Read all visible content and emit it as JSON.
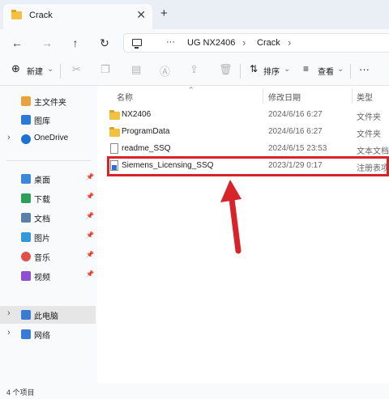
{
  "tab": {
    "title": "Crack",
    "close": "✕",
    "new": "+"
  },
  "nav": {
    "back": "←",
    "forward": "→",
    "up": "↑",
    "refresh": "↻"
  },
  "address": {
    "more": "···",
    "crumbs": [
      "UG NX2406",
      "Crack"
    ],
    "separator": "›"
  },
  "toolbar": {
    "new_label": "新建",
    "sort_label": "排序",
    "view_label": "查看",
    "more": "···"
  },
  "sidebar": {
    "items": [
      {
        "label": "主文件夹",
        "icon": "home-icon",
        "color": "#e8a33d"
      },
      {
        "label": "图库",
        "icon": "gallery-icon",
        "color": "#2a7ad6"
      },
      {
        "label": "OneDrive",
        "icon": "cloud-icon",
        "color": "#1e73d2"
      },
      {
        "label": "桌面",
        "icon": "desktop-icon",
        "color": "#3b88d8"
      },
      {
        "label": "下载",
        "icon": "download-icon",
        "color": "#2aa05a"
      },
      {
        "label": "文档",
        "icon": "documents-icon",
        "color": "#5a7fa8"
      },
      {
        "label": "图片",
        "icon": "pictures-icon",
        "color": "#3598db"
      },
      {
        "label": "音乐",
        "icon": "music-icon",
        "color": "#e0504a"
      },
      {
        "label": "视频",
        "icon": "video-icon",
        "color": "#8d4fd0"
      },
      {
        "label": "此电脑",
        "icon": "computer-icon",
        "color": "#3a7bd5"
      },
      {
        "label": "网络",
        "icon": "network-icon",
        "color": "#3a7bd5"
      }
    ]
  },
  "columns": {
    "name": "名称",
    "date": "修改日期",
    "type": "类型"
  },
  "files": [
    {
      "name": "NX2406",
      "date": "2024/6/16 6:27",
      "type": "文件夹",
      "icon": "folder-icon"
    },
    {
      "name": "ProgramData",
      "date": "2024/6/16 6:27",
      "type": "文件夹",
      "icon": "folder-icon"
    },
    {
      "name": "readme_SSQ",
      "date": "2024/6/15 23:53",
      "type": "文本文档",
      "icon": "text-file-icon"
    },
    {
      "name": "Siemens_Licensing_SSQ",
      "date": "2023/1/29 0:17",
      "type": "注册表项",
      "icon": "registry-file-icon"
    }
  ],
  "status": {
    "count": "4 个项目"
  },
  "colors": {
    "highlight": "#d8232a",
    "arrow": "#d8232a",
    "folder": "#f3c03f"
  }
}
